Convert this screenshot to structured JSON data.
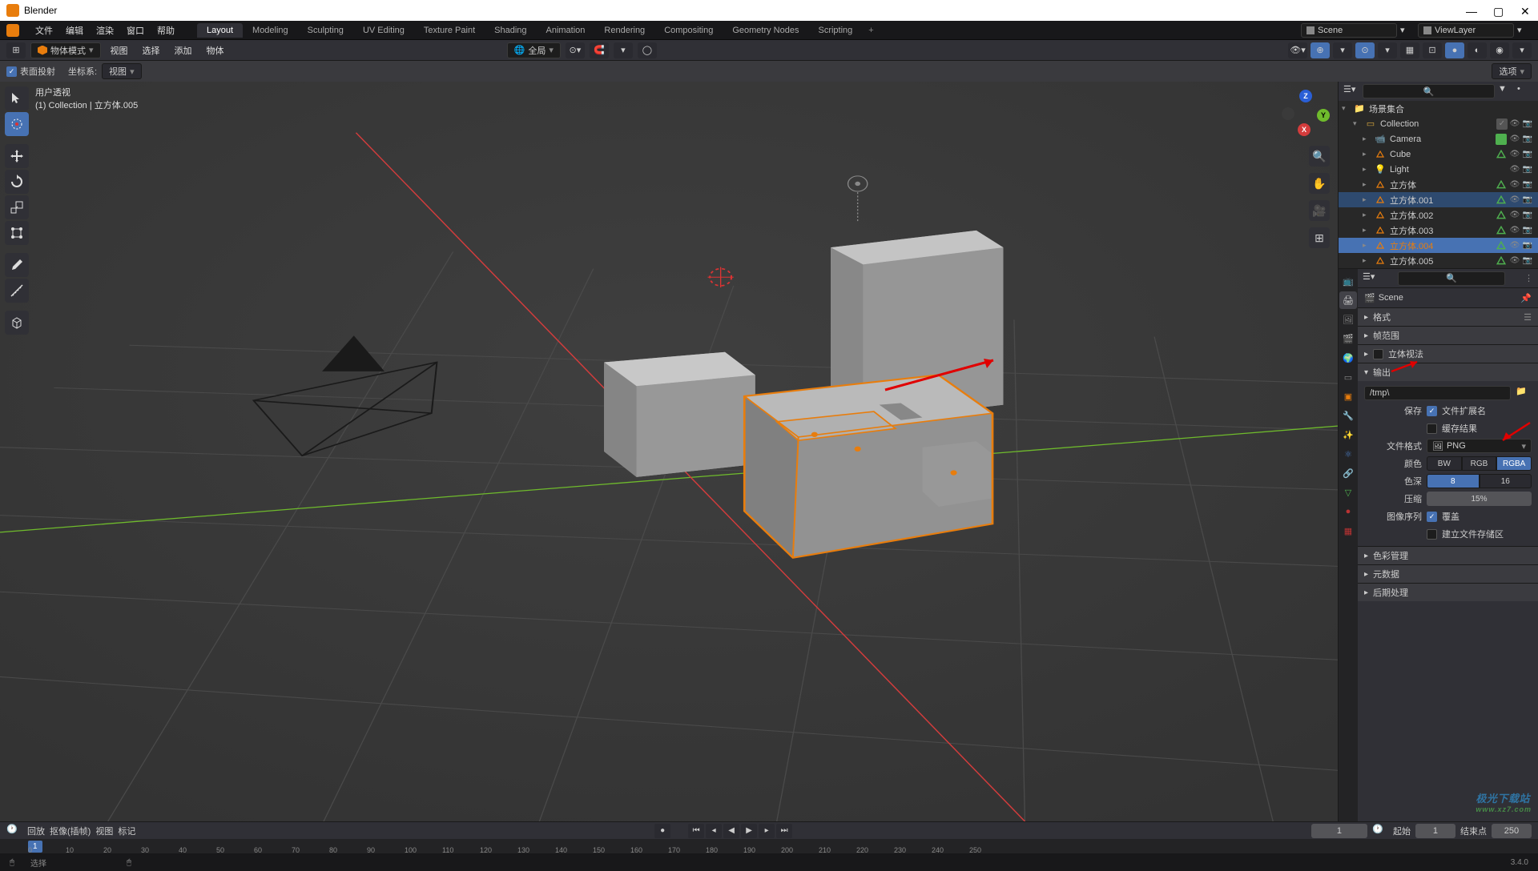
{
  "titlebar": {
    "title": "Blender"
  },
  "menu": [
    "文件",
    "编辑",
    "渲染",
    "窗口",
    "帮助"
  ],
  "workspaces": [
    "Layout",
    "Modeling",
    "Sculpting",
    "UV Editing",
    "Texture Paint",
    "Shading",
    "Animation",
    "Rendering",
    "Compositing",
    "Geometry Nodes",
    "Scripting"
  ],
  "scene_label": "Scene",
  "viewlayer_label": "ViewLayer",
  "subheader": {
    "mode": "物体模式",
    "menus": [
      "视图",
      "选择",
      "添加",
      "物体"
    ],
    "orient_label": "全局",
    "options": "选项"
  },
  "subrow2": {
    "projection": "表面投射",
    "coord_system_label": "坐标系:",
    "coord_system": "视图"
  },
  "vp_info": {
    "line1": "用户透视",
    "line2": "(1) Collection | 立方体.005"
  },
  "outliner": {
    "root": "场景集合",
    "collection": "Collection",
    "items": [
      {
        "name": "Camera",
        "type": "camera",
        "selected": false
      },
      {
        "name": "Cube",
        "type": "mesh",
        "selected": false
      },
      {
        "name": "Light",
        "type": "light",
        "selected": false
      },
      {
        "name": "立方体",
        "type": "mesh",
        "selected": false
      },
      {
        "name": "立方体.001",
        "type": "mesh",
        "selected": true
      },
      {
        "name": "立方体.002",
        "type": "mesh",
        "selected": false
      },
      {
        "name": "立方体.003",
        "type": "mesh",
        "selected": false
      },
      {
        "name": "立方体.004",
        "type": "mesh",
        "selected": true,
        "active": true
      },
      {
        "name": "立方体.005",
        "type": "mesh",
        "selected": false
      }
    ]
  },
  "properties": {
    "scene_name": "Scene",
    "panels": {
      "format": "格式",
      "frame_range": "帧范围",
      "stereo": "立体视法",
      "output": "输出",
      "color_mgmt": "色彩管理",
      "metadata": "元数据",
      "post": "后期处理"
    },
    "output": {
      "path": "/tmp\\",
      "save_label": "保存",
      "file_ext_label": "文件扩展名",
      "cache_result_label": "缓存结果",
      "file_format_label": "文件格式",
      "file_format": "PNG",
      "color_label": "颜色",
      "color_modes": [
        "BW",
        "RGB",
        "RGBA"
      ],
      "depth_label": "色深",
      "depths": [
        "8",
        "16"
      ],
      "compression_label": "压缩",
      "compression": "15%",
      "sequence_label": "图像序列",
      "overwrite_label": "覆盖",
      "placeholders_label": "建立文件存储区"
    }
  },
  "timeline": {
    "menus": [
      "回放",
      "抠像(插帧)",
      "视图",
      "标记"
    ],
    "current": "1",
    "start_label": "起始",
    "start": "1",
    "end_label": "结束点",
    "end": "250",
    "ticks": [
      "0",
      "10",
      "20",
      "30",
      "40",
      "50",
      "60",
      "70",
      "80",
      "90",
      "100",
      "110",
      "120",
      "130",
      "140",
      "150",
      "160",
      "170",
      "180",
      "190",
      "200",
      "210",
      "220",
      "230",
      "240",
      "250"
    ]
  },
  "statusbar": {
    "select": "选择",
    "version": "3.4.0"
  },
  "watermark": {
    "line1": "极光下载站",
    "line2": "www.xz7.com"
  }
}
